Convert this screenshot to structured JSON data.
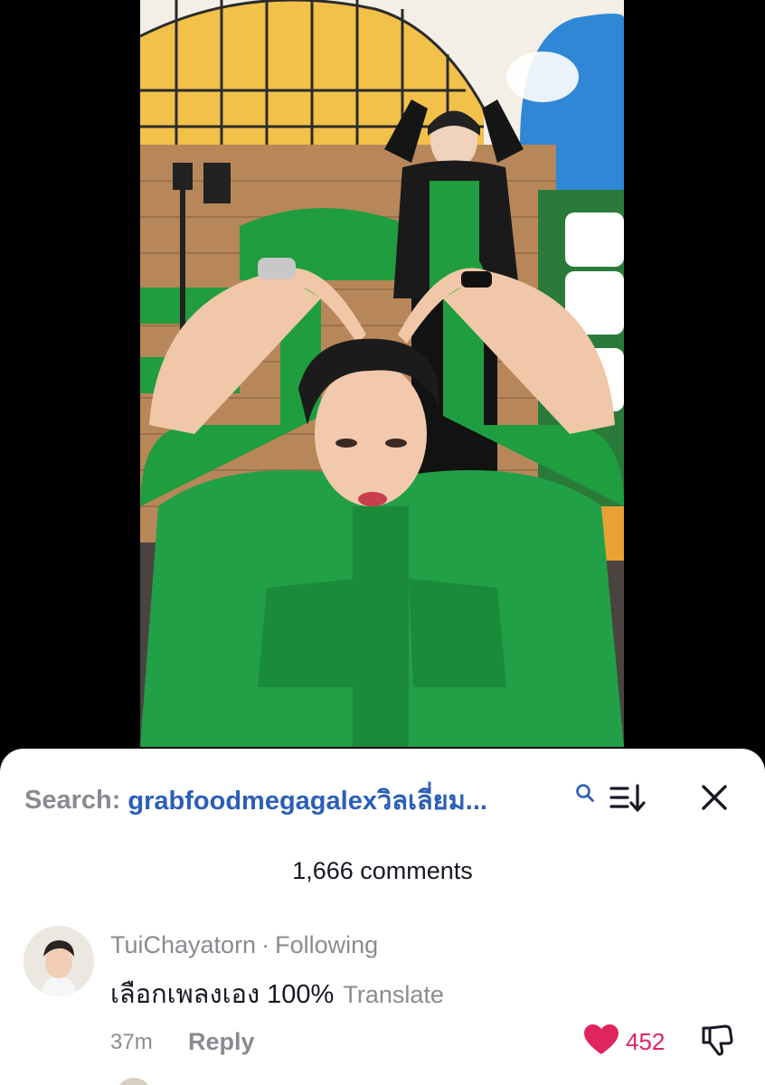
{
  "video": {
    "description_hidden": ""
  },
  "search": {
    "prefix": "Search:",
    "term": "grabfoodmegagalexวิลเลี่ยม..."
  },
  "icons": {
    "search": "search-icon",
    "sort": "sort-icon",
    "close": "close-icon",
    "like": "heart-icon",
    "dislike": "thumbs-down-icon"
  },
  "comments": {
    "count_label": "1,666 comments",
    "items": [
      {
        "username": "TuiChayatorn",
        "separator": "·",
        "relation": "Following",
        "text": "เลือกเพลงเอง 100%",
        "translate_label": "Translate",
        "time": "37m",
        "reply_label": "Reply",
        "likes": "452",
        "liked": true
      }
    ]
  },
  "colors": {
    "search_term": "#2b5fb8",
    "like": "#e0245e",
    "muted": "#8a8b91",
    "jacket_green": "#1f9d3f"
  }
}
